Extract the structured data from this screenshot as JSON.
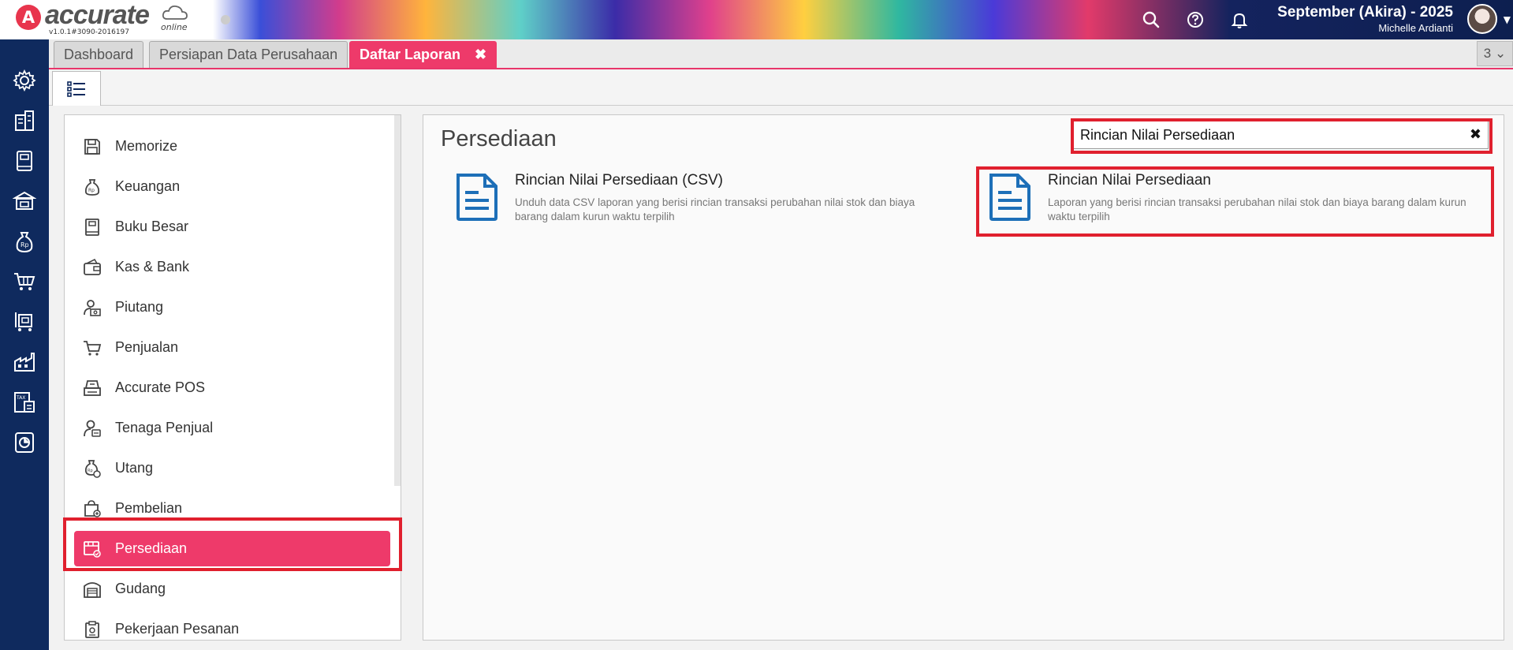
{
  "app": {
    "logo_mark": "A",
    "logo_text": "accurate",
    "logo_sub": "online",
    "version": "v1.0.1#3090-2016197",
    "company": "September (Akira) - 2025",
    "user": "Michelle Ardianti",
    "accent": "#ee3a6a",
    "nav_bg": "#0f2a5e"
  },
  "topbar": {
    "icons": [
      "search-icon",
      "help-icon",
      "bell-icon"
    ]
  },
  "leftnav": {
    "icons": [
      "gear-icon",
      "building-icon",
      "book-icon",
      "bank-icon",
      "money-bag-icon",
      "cart-icon",
      "pos-icon",
      "factory-icon",
      "tax-icon",
      "chart-icon"
    ]
  },
  "tabs": [
    {
      "label": "Dashboard",
      "active": false
    },
    {
      "label": "Persiapan Data Perusahaan",
      "active": false
    },
    {
      "label": "Daftar Laporan",
      "active": true,
      "close": "✖"
    }
  ],
  "tab_count": "3",
  "menu": {
    "items": [
      {
        "label": "Memorize",
        "icon": "floppy-icon"
      },
      {
        "label": "Keuangan",
        "icon": "money-bag-icon"
      },
      {
        "label": "Buku Besar",
        "icon": "ledger-icon"
      },
      {
        "label": "Kas & Bank",
        "icon": "wallet-icon"
      },
      {
        "label": "Piutang",
        "icon": "receivable-icon"
      },
      {
        "label": "Penjualan",
        "icon": "cart-icon"
      },
      {
        "label": "Accurate POS",
        "icon": "pos-icon"
      },
      {
        "label": "Tenaga Penjual",
        "icon": "salesperson-icon"
      },
      {
        "label": "Utang",
        "icon": "payable-icon"
      },
      {
        "label": "Pembelian",
        "icon": "purchase-bag-icon"
      },
      {
        "label": "Persediaan",
        "icon": "inventory-icon",
        "active": true
      },
      {
        "label": "Gudang",
        "icon": "warehouse-icon"
      },
      {
        "label": "Pekerjaan Pesanan",
        "icon": "job-order-icon"
      }
    ]
  },
  "main": {
    "title": "Persediaan",
    "search_value": "Rincian Nilai Persediaan",
    "search_clear": "✖",
    "reports": [
      {
        "title": "Rincian Nilai Persediaan (CSV)",
        "desc_line1": "Unduh data CSV laporan yang berisi rincian transaksi perubahan nilai stok dan biaya",
        "desc_line2": "barang dalam kurun waktu terpilih"
      },
      {
        "title": "Rincian Nilai Persediaan",
        "desc_line1": "Laporan yang berisi rincian transaksi perubahan nilai stok dan biaya barang dalam kurun",
        "desc_line2": "waktu terpilih"
      }
    ]
  }
}
